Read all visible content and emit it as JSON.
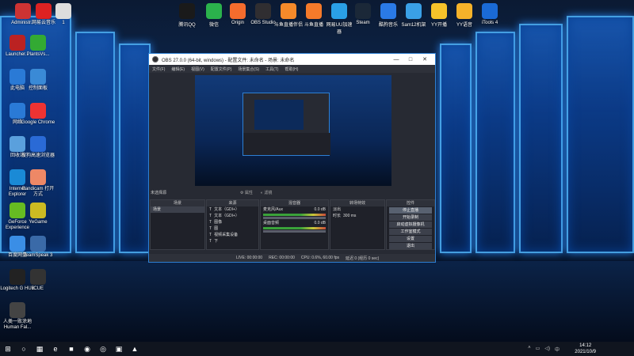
{
  "desktop_left": [
    {
      "label": "Administr...",
      "color": "#c33"
    },
    {
      "label": "网易云音乐",
      "color": "#d22"
    },
    {
      "label": "1",
      "color": "#ddd"
    },
    {
      "label": "Launcher...",
      "color": "#b22"
    },
    {
      "label": "PlantsVs...",
      "color": "#3a3"
    },
    {
      "label": "此电脑",
      "color": "#2a7ad6"
    },
    {
      "label": "控制面板",
      "color": "#3a8ad6"
    },
    {
      "label": "网络",
      "color": "#2a7ad6"
    },
    {
      "label": "Google Chrome",
      "color": "#e33"
    },
    {
      "label": "回收站",
      "color": "#5aa0dd"
    },
    {
      "label": "搜狗高速浏览器",
      "color": "#2a6ad6"
    },
    {
      "label": "Internet Explorer",
      "color": "#1a8ad6"
    },
    {
      "label": "Bandicam 打开方式",
      "color": "#e86"
    },
    {
      "label": "GeForce Experience",
      "color": "#6b2"
    },
    {
      "label": "YeGame",
      "color": "#cb2"
    },
    {
      "label": "百度网盘",
      "color": "#3a8ee6"
    },
    {
      "label": "TeamSpeak 3",
      "color": "#3a6aa8"
    },
    {
      "label": "Logitech G HUB",
      "color": "#222"
    },
    {
      "label": "iCUE",
      "color": "#333"
    },
    {
      "label": "人类一败涂地 Human Fal...",
      "color": "#444"
    }
  ],
  "desktop_top": [
    {
      "label": "腾讯QQ",
      "color": "#1a1a1a"
    },
    {
      "label": "微信",
      "color": "#2bb24c"
    },
    {
      "label": "Origin",
      "color": "#f56c2d"
    },
    {
      "label": "OBS Studio",
      "color": "#302e31"
    },
    {
      "label": "斗鱼直播伴侣",
      "color": "#f58a2a"
    },
    {
      "label": "斗鱼直播",
      "color": "#f57a2a"
    },
    {
      "label": "网易UU加速器",
      "color": "#2aa0e6"
    },
    {
      "label": "Steam",
      "color": "#1b2838"
    },
    {
      "label": "酷狗音乐",
      "color": "#2a7ae6"
    },
    {
      "label": "Sam12机架",
      "color": "#3aa0e6"
    },
    {
      "label": "YY开播",
      "color": "#f5c22a"
    },
    {
      "label": "YY语音",
      "color": "#f5b22a"
    },
    {
      "label": "iTools 4",
      "color": "#1a6ad6"
    }
  ],
  "obs": {
    "title": "OBS 27.0.0 (64-bit, windows) - 配置文件: 未命名 - 场景: 未命名",
    "menu": [
      "文件(F)",
      "编辑(E)",
      "视图(V)",
      "配置文件(P)",
      "场景集合(S)",
      "工具(T)",
      "帮助(H)"
    ],
    "scene_label": "未选择源",
    "props_btn": "属性",
    "filters_btn": "滤镜",
    "docks": {
      "scenes": "场景",
      "sources": "来源",
      "mixer": "混音器",
      "transitions": "转场特效",
      "controls": "控件"
    },
    "scene_items": [
      "场景"
    ],
    "source_items": [
      "文本（GDI+）",
      "文本（GDI+）",
      "图像",
      "图",
      "视频采集设备",
      "下"
    ],
    "mixer_items": [
      {
        "name": "麦克风/Aux",
        "db": "0.0 dB"
      },
      {
        "name": "桌面音频",
        "db": "0.0 dB"
      }
    ],
    "transition": "淡出",
    "duration_label": "时长",
    "duration": "300 ms",
    "controls": [
      "停止直播",
      "开始录制",
      "启动虚拟摄像机",
      "工作室模式",
      "设置",
      "退出"
    ],
    "status": [
      "LIVE: 00:00:00",
      "REC: 00:00:00",
      "CPU: 0.6%, 60.00 fps",
      "延迟 0 (经历 0 sec)"
    ]
  },
  "taskbar": {
    "time": "14:12",
    "date": "2021/10/9",
    "lang": "中",
    "apps": [
      "⊞",
      "○",
      "▦",
      "e",
      "■",
      "◉",
      "◎",
      "▣",
      "▲"
    ]
  }
}
